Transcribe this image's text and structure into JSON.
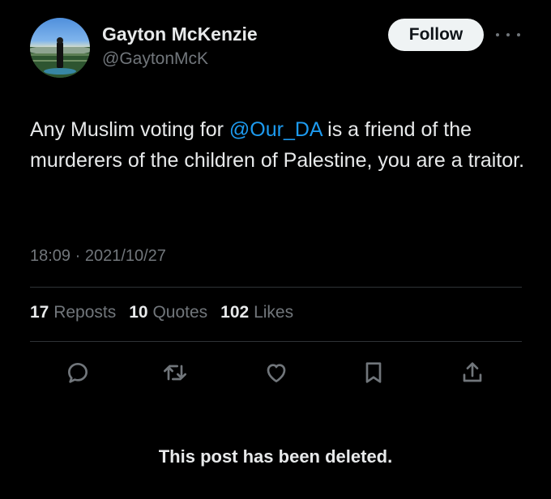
{
  "author": {
    "name": "Gayton McKenzie",
    "handle": "@GaytonMcK",
    "avatar_icon": "profile-photo"
  },
  "follow_label": "Follow",
  "tweet": {
    "text_before": "Any Muslim voting for ",
    "mention": "@Our_DA",
    "text_after": " is a friend of the murderers of the children of Palestine, you are a traitor.",
    "timestamp": "18:09 · 2021/10/27"
  },
  "stats": {
    "reposts_count": "17",
    "reposts_label": "Reposts",
    "quotes_count": "10",
    "quotes_label": "Quotes",
    "likes_count": "102",
    "likes_label": "Likes"
  },
  "actions": [
    "reply-icon",
    "repost-icon",
    "like-icon",
    "bookmark-icon",
    "share-icon"
  ],
  "deleted_notice": "This post has been deleted.",
  "colors": {
    "background": "#000000",
    "text": "#e7e9ea",
    "muted": "#71767b",
    "link": "#1d9bf0",
    "divider": "#2f3336"
  }
}
